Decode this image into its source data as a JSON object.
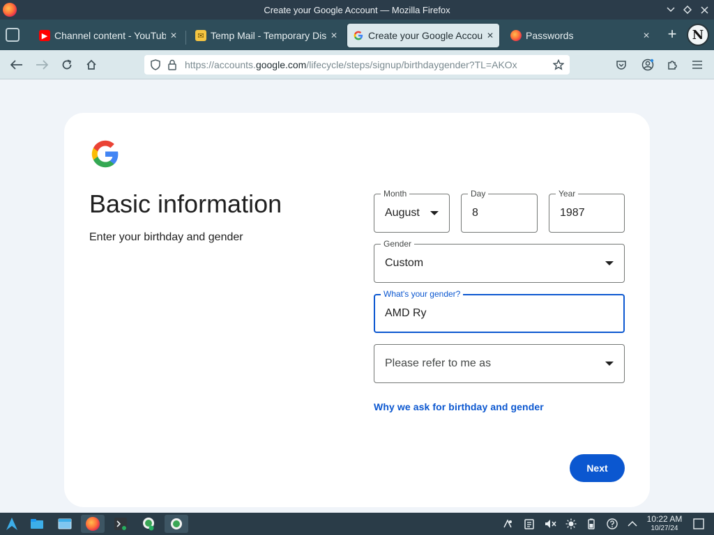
{
  "window": {
    "title": "Create your Google Account — Mozilla Firefox"
  },
  "tabs": [
    {
      "label": "Channel content - YouTube",
      "icon": "youtube-icon",
      "active": false
    },
    {
      "label": "Temp Mail - Temporary Disposable Email",
      "icon": "tempmail-icon",
      "active": false
    },
    {
      "label": "Create your Google Account",
      "icon": "google-icon",
      "active": true
    },
    {
      "label": "Passwords",
      "icon": "firefox-icon",
      "active": false
    }
  ],
  "url": {
    "prefix": "https://accounts.",
    "host": "google.com",
    "path": "/lifecycle/steps/signup/birthdaygender?TL=AKOx"
  },
  "page": {
    "heading": "Basic information",
    "subheading": "Enter your birthday and gender",
    "month": {
      "label": "Month",
      "value": "August"
    },
    "day": {
      "label": "Day",
      "value": "8"
    },
    "year": {
      "label": "Year",
      "value": "1987"
    },
    "gender": {
      "label": "Gender",
      "value": "Custom"
    },
    "custom_gender": {
      "label": "What's your gender?",
      "value": "AMD Ry"
    },
    "pronoun": {
      "placeholder": "Please refer to me as"
    },
    "why_link": "Why we ask for birthday and gender",
    "next_button": "Next"
  },
  "taskbar": {
    "time": "10:22 AM",
    "date": "10/27/24"
  },
  "colors": {
    "accent": "#0b57d0",
    "titlebar": "#2b3c4a",
    "tabstrip": "#2e4d5a",
    "toolbar": "#dbe8ec"
  }
}
